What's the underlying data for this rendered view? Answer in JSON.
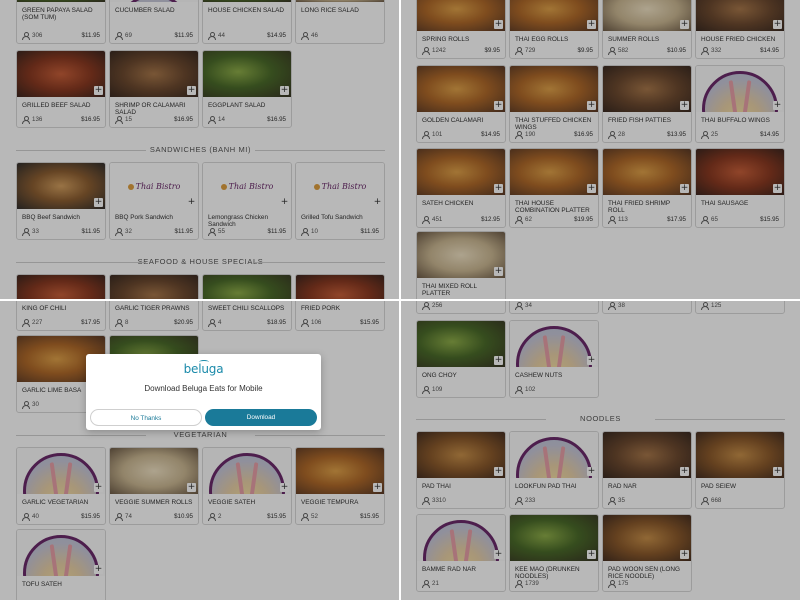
{
  "app": {
    "brand": "beluga",
    "accent": "#1a7a99"
  },
  "modal": {
    "logo_text": "beluga",
    "title": "Download Beluga Eats for Mobile",
    "no_thanks_label": "No Thanks",
    "download_label": "Download"
  },
  "sections": {
    "sandwiches": "SANDWICHES (BANH MI)",
    "seafood": "SEAFOOD & HOUSE SPECIALS",
    "vegetarian": "VEGETARIAN",
    "noodles": "NOODLES"
  },
  "placeholder_logo_text": "Thai Bistro",
  "quadrants": {
    "top_left": [
      {
        "name": "GREEN PAPAYA SALAD (SOM TUM)",
        "count": "306",
        "price": "$11.95",
        "image": "food-green"
      },
      {
        "name": "CUCUMBER SALAD",
        "count": "69",
        "price": "$11.95",
        "image": "placeholder"
      },
      {
        "name": "HOUSE CHICKEN SALAD",
        "count": "44",
        "price": "$14.95",
        "image": "food-green"
      },
      {
        "name": "LONG RICE SALAD",
        "count": "46",
        "price": "",
        "image": "food-pale"
      },
      {
        "name": "GRILLED BEEF SALAD",
        "count": "136",
        "price": "$16.95",
        "image": "food-red"
      },
      {
        "name": "SHRIMP OR CALAMARI SALAD",
        "count": "15",
        "price": "$16.95",
        "image": "food-meat"
      },
      {
        "name": "EGGPLANT SALAD",
        "count": "14",
        "price": "$16.95",
        "image": "food-green"
      },
      {
        "name": "BBQ Beef Sandwich",
        "count": "33",
        "price": "$11.95",
        "image": "food-sandwich"
      },
      {
        "name": "BBQ Pork Sandwich",
        "count": "32",
        "price": "$11.95",
        "image": "logo"
      },
      {
        "name": "Lemongrass Chicken Sandwich",
        "count": "55",
        "price": "$11.95",
        "image": "logo"
      },
      {
        "name": "Grilled Tofu Sandwich",
        "count": "10",
        "price": "$11.95",
        "image": "logo"
      }
    ],
    "top_right": [
      {
        "name": "SPRING ROLLS",
        "count": "1242",
        "price": "$9.95",
        "image": "food-fried"
      },
      {
        "name": "THAI EGG ROLLS",
        "count": "729",
        "price": "$9.95",
        "image": "food-fried"
      },
      {
        "name": "SUMMER ROLLS",
        "count": "582",
        "price": "$10.95",
        "image": "food-pale"
      },
      {
        "name": "HOUSE FRIED CHICKEN",
        "count": "332",
        "price": "$14.95",
        "image": "food-meat"
      },
      {
        "name": "GOLDEN CALAMARI",
        "count": "101",
        "price": "$14.95",
        "image": "food-fried"
      },
      {
        "name": "THAI STUFFED CHICKEN WINGS",
        "count": "190",
        "price": "$16.95",
        "image": "food-fried"
      },
      {
        "name": "FRIED FISH PATTIES",
        "count": "28",
        "price": "$13.95",
        "image": "food-meat"
      },
      {
        "name": "THAI BUFFALO WINGS",
        "count": "25",
        "price": "$14.95",
        "image": "placeholder"
      },
      {
        "name": "SATEH CHICKEN",
        "count": "451",
        "price": "$12.95",
        "image": "food-fried"
      },
      {
        "name": "THAI HOUSE COMBINATION PLATTER",
        "count": "62",
        "price": "$19.95",
        "image": "food-fried"
      },
      {
        "name": "THAI FRIED SHRIMP ROLL",
        "count": "113",
        "price": "$17.95",
        "image": "food-fried"
      },
      {
        "name": "THAI SAUSAGE",
        "count": "65",
        "price": "$15.95",
        "image": "food-red"
      },
      {
        "name": "THAI MIXED ROLL PLATTER",
        "count": "",
        "price": "",
        "image": "food-pale"
      }
    ],
    "bottom_left": [
      {
        "name": "KING OF CHILI",
        "count": "227",
        "price": "$17.95",
        "image": "food-red"
      },
      {
        "name": "GARLIC TIGER PRAWNS",
        "count": "8",
        "price": "$20.95",
        "image": "food-meat"
      },
      {
        "name": "SWEET CHILI SCALLOPS",
        "count": "4",
        "price": "$18.95",
        "image": "food-green"
      },
      {
        "name": "FRIED PORK",
        "count": "106",
        "price": "$15.95",
        "image": "food-red"
      },
      {
        "name": "GARLIC LIME BASA",
        "count": "30",
        "price": "",
        "image": "food-fried"
      },
      {
        "name": "",
        "count": "",
        "price": "",
        "image": "food-green"
      },
      {
        "name": "GARLIC VEGETARIAN",
        "count": "40",
        "price": "$15.95",
        "image": "placeholder"
      },
      {
        "name": "VEGGIE SUMMER ROLLS",
        "count": "74",
        "price": "$10.95",
        "image": "food-pale"
      },
      {
        "name": "VEGGIE SATEH",
        "count": "2",
        "price": "$15.95",
        "image": "placeholder"
      },
      {
        "name": "VEGGIE TEMPURA",
        "count": "52",
        "price": "$15.95",
        "image": "food-fried"
      },
      {
        "name": "TOFU SATEH",
        "count": "",
        "price": "",
        "image": "placeholder"
      }
    ],
    "bottom_right": [
      {
        "name": "",
        "count": "256",
        "price": "",
        "image": "none"
      },
      {
        "name": "",
        "count": "34",
        "price": "",
        "image": "none"
      },
      {
        "name": "",
        "count": "38",
        "price": "",
        "image": "none"
      },
      {
        "name": "",
        "count": "125",
        "price": "",
        "image": "none"
      },
      {
        "name": "ONG CHOY",
        "count": "109",
        "price": "",
        "image": "food-green"
      },
      {
        "name": "CASHEW NUTS",
        "count": "102",
        "price": "",
        "image": "placeholder"
      },
      {
        "name": "PAD THAI",
        "count": "3310",
        "price": "",
        "image": "food-noodle"
      },
      {
        "name": "LOOKFUN PAD THAI",
        "count": "233",
        "price": "",
        "image": "placeholder"
      },
      {
        "name": "RAD NAR",
        "count": "35",
        "price": "",
        "image": "food-meat"
      },
      {
        "name": "PAD SEIEW",
        "count": "668",
        "price": "",
        "image": "food-noodle"
      },
      {
        "name": "BAMME RAD NAR",
        "count": "21",
        "price": "",
        "image": "placeholder"
      },
      {
        "name": "KEE MAO (DRUNKEN NOODLES)",
        "count": "1739",
        "price": "",
        "image": "food-green"
      },
      {
        "name": "PAD WOON SEN (LONG RICE NOODLE)",
        "count": "175",
        "price": "",
        "image": "food-noodle"
      }
    ]
  }
}
